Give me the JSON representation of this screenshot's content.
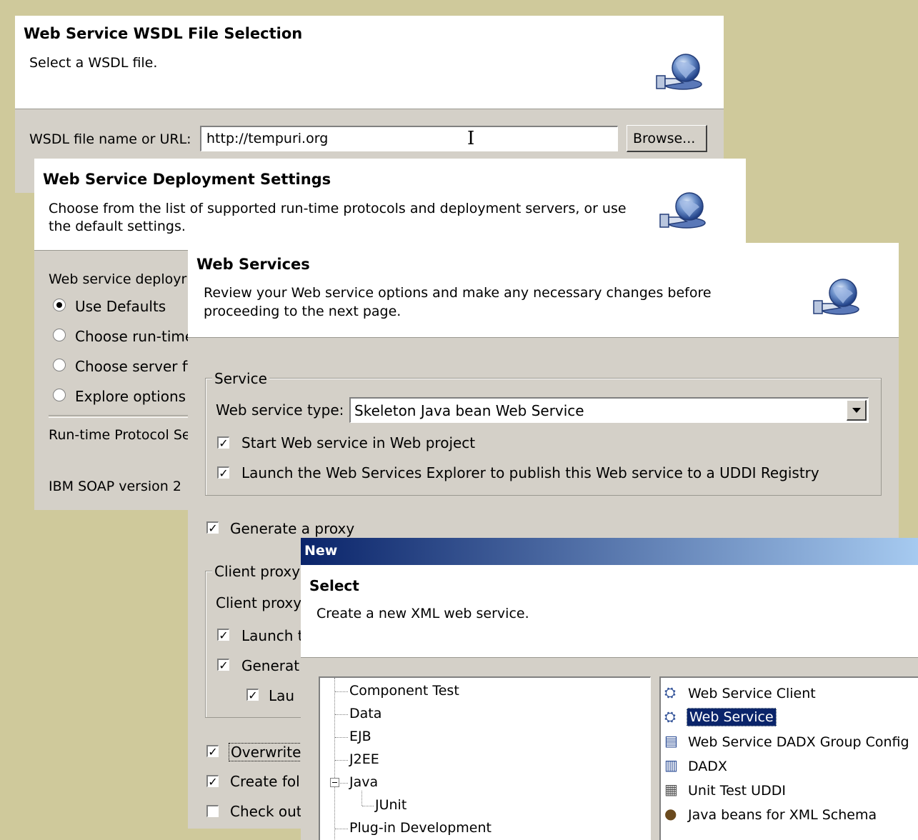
{
  "wsdl_page": {
    "title": "Web Service WSDL File Selection",
    "description": "Select a WSDL file.",
    "field_label": "WSDL file name or URL:",
    "field_value": "http://tempuri.org",
    "browse_label": "Browse..."
  },
  "deploy_page": {
    "title": "Web Service Deployment Settings",
    "description_line1": "Choose from the list of supported run-time protocols and deployment servers, or use",
    "description_line2": "the default settings.",
    "section_label": "Web service deployr",
    "options": [
      "Use Defaults",
      "Choose run-time",
      "Choose server fi",
      "Explore options"
    ],
    "runtime_label": "Run-time Protocol Se",
    "runtime_value": "IBM SOAP version 2"
  },
  "services_page": {
    "title": "Web Services",
    "description_line1": "Review your Web service options and make any necessary changes before",
    "description_line2": "proceeding to the next page.",
    "service_group": "Service",
    "type_label": "Web service type:",
    "type_value": "Skeleton Java bean Web Service",
    "start_service": "Start Web service in Web project",
    "launch_explorer": "Launch the Web Services Explorer to publish this Web service to a UDDI Registry",
    "generate_proxy": "Generate a proxy",
    "client_group": "Client proxy",
    "client_label": "Client proxy",
    "launch_partial": "Launch t",
    "generate_partial": "Generat",
    "lau_partial": "Lau",
    "overwrite": "Overwrite",
    "create_fol": "Create fol",
    "check_out": "Check out"
  },
  "new_dialog": {
    "titlebar": "New",
    "title": "Select",
    "description": "Create a new XML web service.",
    "tree": [
      "Component Test",
      "Data",
      "EJB",
      "J2EE",
      "Java",
      "JUnit",
      "Plug-in Development"
    ],
    "list": [
      "Web Service Client",
      "Web Service",
      "Web Service DADX Group Config",
      "DADX",
      "Unit Test UDDI",
      "Java beans for XML Schema"
    ],
    "selected_item": "Web Service"
  },
  "colors": {
    "background": "#cfc99b",
    "panel": "#d4d0c8",
    "selection": "#0a246a",
    "titlebar_start": "#0a246a",
    "titlebar_end": "#a6caf0"
  }
}
